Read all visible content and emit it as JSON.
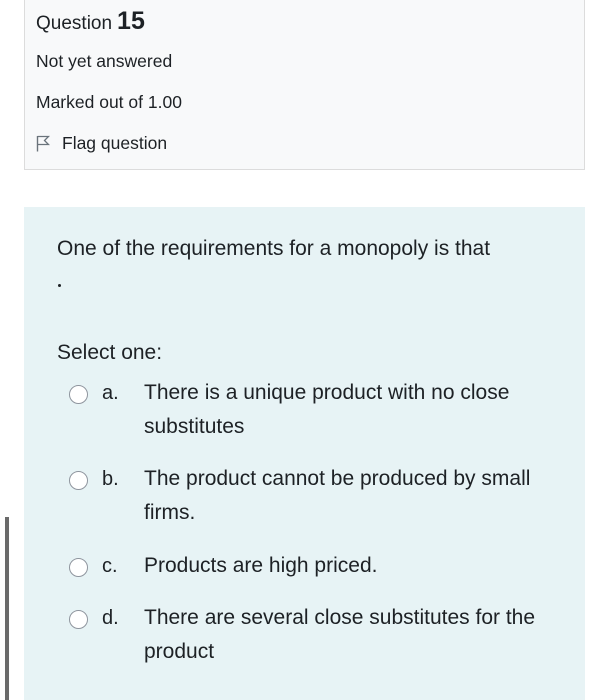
{
  "question_info": {
    "title_prefix": "Question",
    "number": "15",
    "status": "Not yet answered",
    "marks": "Marked out of 1.00",
    "flag_label": "Flag question"
  },
  "question": {
    "text": "One of the requirements for a monopoly is that",
    "blank": ".",
    "prompt": "Select one:",
    "options": [
      {
        "letter": "a.",
        "text": "There is a unique product with no close substitutes"
      },
      {
        "letter": "b.",
        "text": "The product cannot be produced by small firms."
      },
      {
        "letter": "c.",
        "text": "Products are high priced."
      },
      {
        "letter": "d.",
        "text": "There are several close substitutes for the product"
      }
    ]
  },
  "colors": {
    "info_background": "#f8f9fa",
    "question_background": "#e7f3f5",
    "text": "#1d2125",
    "radio_border": "#8f959e"
  },
  "icons": {
    "flag": "flag-outline-icon",
    "radio": "radio-unchecked-icon"
  }
}
